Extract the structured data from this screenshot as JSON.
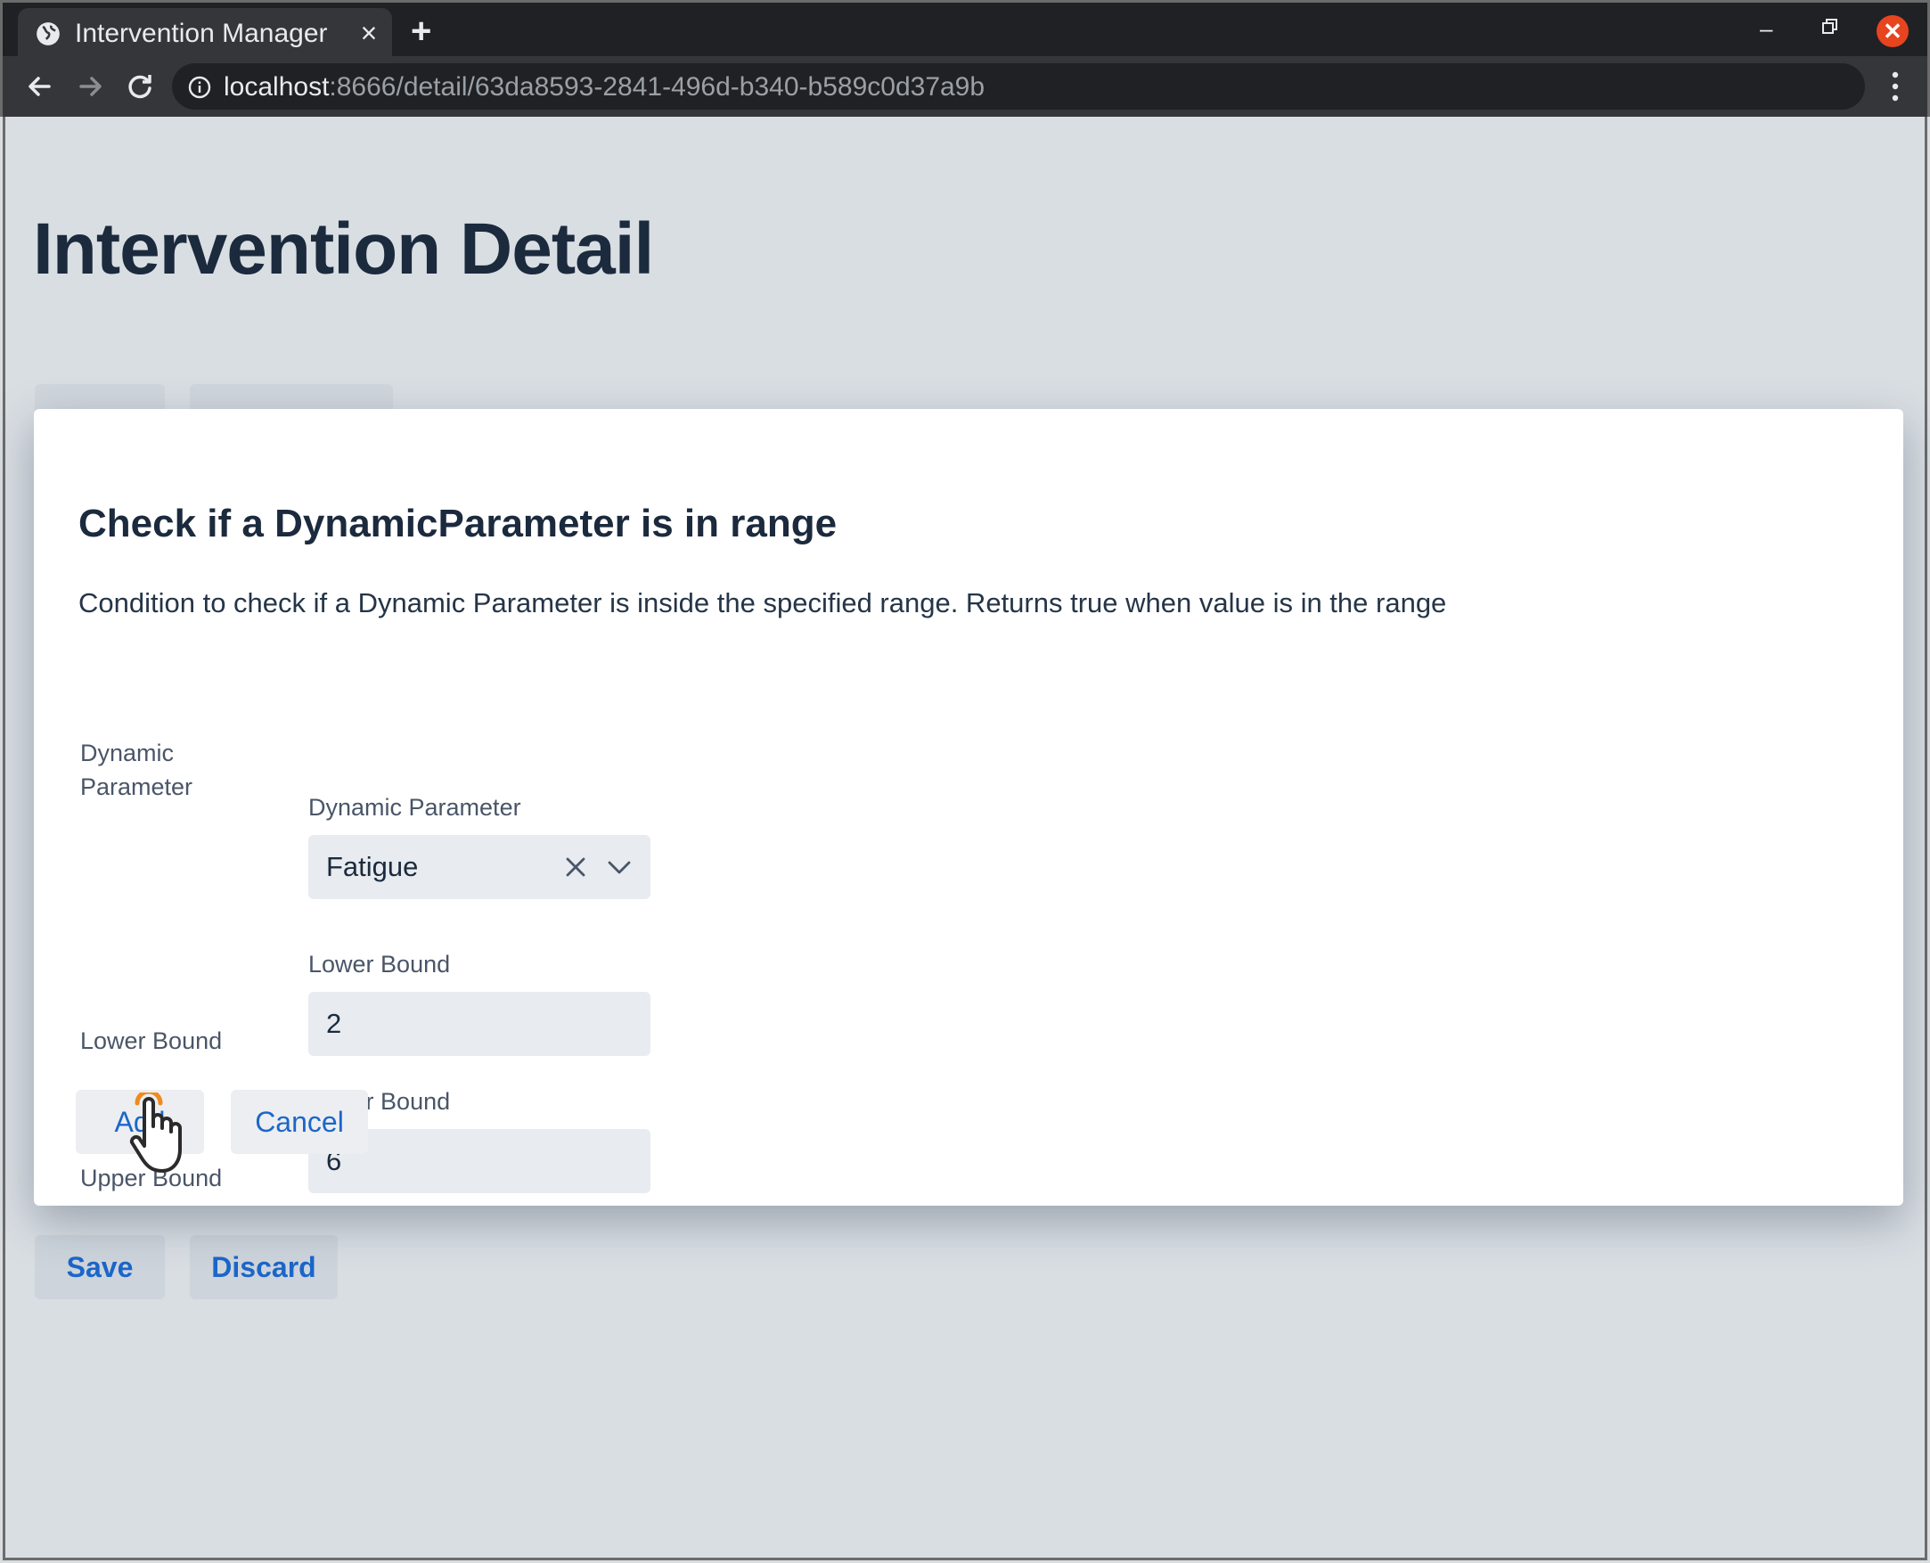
{
  "browser": {
    "tab_title": "Intervention Manager",
    "tab_close": "×",
    "new_tab": "+",
    "url_host": "localhost",
    "url_path": ":8666/detail/63da8593-2841-496d-b340-b589c0d37a9b",
    "window_close": "✕",
    "window_minimize": "–"
  },
  "page": {
    "title": "Intervention Detail",
    "save_label": "Save",
    "discard_label": "Discard"
  },
  "modal": {
    "title": "Check if a DynamicParameter is in range",
    "description": "Condition to check if a Dynamic Parameter is inside the specified range. Returns true when value is in the range",
    "fields": {
      "dynamic_parameter": {
        "row_label_line1": "Dynamic",
        "row_label_line2": "Parameter",
        "field_label": "Dynamic Parameter",
        "value": "Fatigue"
      },
      "lower_bound": {
        "row_label": "Lower Bound",
        "field_label": "Lower Bound",
        "value": "2"
      },
      "upper_bound": {
        "row_label": "Upper Bound",
        "field_label": "Upper Bound",
        "value": "6"
      }
    },
    "add_label": "Add",
    "cancel_label": "Cancel"
  },
  "icons": {
    "favicon": "globe-icon",
    "back": "arrow-left-icon",
    "forward": "arrow-right-icon",
    "reload": "reload-icon",
    "info": "info-icon",
    "menu": "vertical-dots-icon",
    "clear": "close-icon",
    "dropdown": "chevron-down-icon",
    "cursor": "hand-pointer-icon"
  },
  "colors": {
    "accent": "#1c66c9",
    "title": "#1b2a3d",
    "close_button": "#e8441f"
  }
}
